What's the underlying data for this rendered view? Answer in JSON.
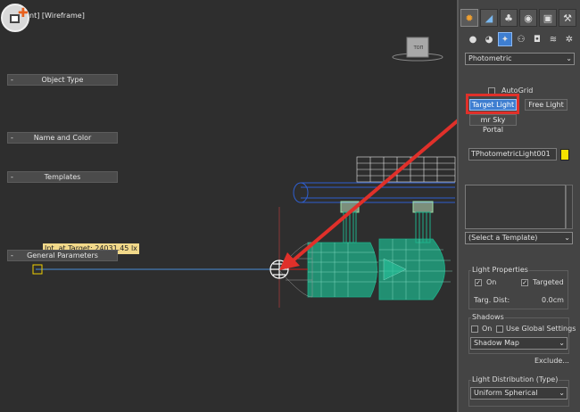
{
  "viewport": {
    "label": "[+] [Top] [Wireframe]",
    "label_visible": "nt] [Wireframe]",
    "tooltip": "Int. at Target: 24031.45 lx",
    "cube_label": "ТОП"
  },
  "panel": {
    "tabs": [
      "create-icon",
      "modify-icon",
      "hierarchy-icon",
      "motion-icon",
      "display-icon",
      "utilities-icon"
    ],
    "categories": [
      "geometry-icon",
      "shapes-icon",
      "lights-icon",
      "cameras-icon",
      "helpers-icon",
      "spacewarps-icon",
      "systems-icon"
    ],
    "type_dropdown": "Photometric",
    "object_type": {
      "title": "Object Type",
      "autogrid_label": "AutoGrid",
      "target_light": "Target Light",
      "free_light": "Free Light",
      "mr_sky_portal": "mr Sky Portal"
    },
    "name_color": {
      "title": "Name and Color",
      "name_value": "TPhotometricLight001",
      "color": "#f5e200"
    },
    "templates": {
      "title": "Templates",
      "select_value": "(Select a Template)"
    },
    "general": {
      "title": "General Parameters",
      "light_properties": "Light Properties",
      "on_label": "On",
      "targeted_label": "Targeted",
      "targ_dist_label": "Targ. Dist:",
      "targ_dist_value": "0.0cm",
      "shadows": "Shadows",
      "shadows_on": "On",
      "use_global": "Use Global Settings",
      "shadow_type": "Shadow Map",
      "exclude": "Exclude...",
      "light_distribution": "Light Distribution (Type)",
      "distribution_value": "Uniform Spherical"
    }
  },
  "colors": {
    "annotation_red": "#e0302a",
    "mesh_teal": "#1fb08a",
    "mesh_blue": "#2f5fd0",
    "selection_blue": "#3e7ed0"
  }
}
